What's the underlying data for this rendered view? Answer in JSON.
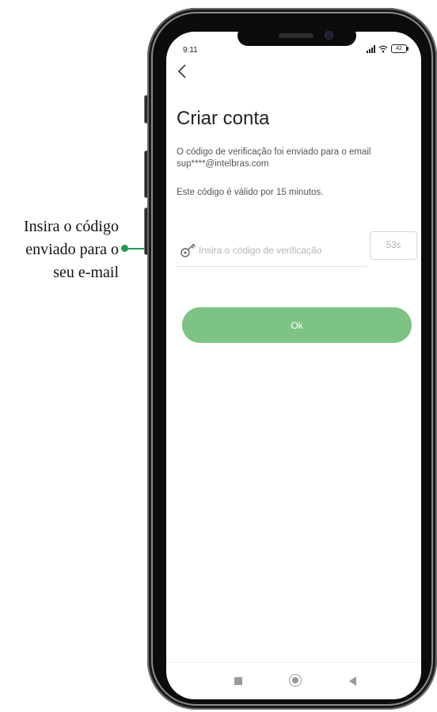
{
  "annotation": {
    "lines": [
      "Insira o código",
      "enviado para o",
      "seu e-mail"
    ],
    "color": "#1f9b4f"
  },
  "status_bar": {
    "time": "9:11",
    "battery": "42",
    "icons": [
      "signal-icon",
      "wifi-icon",
      "battery-icon"
    ]
  },
  "screen": {
    "title": "Criar conta",
    "description": "O código de verificação foi enviado para o email sup****@intelbras.com",
    "validity": "Este código é válido por 15 minutos.",
    "code_input": {
      "placeholder": "Insira o código de verificação",
      "value": ""
    },
    "timer_label": "53s",
    "ok_label": "Ok",
    "accent_color": "#7dc384"
  },
  "nav_bar": {
    "icons": [
      "recent-apps-icon",
      "home-icon",
      "back-icon"
    ]
  }
}
